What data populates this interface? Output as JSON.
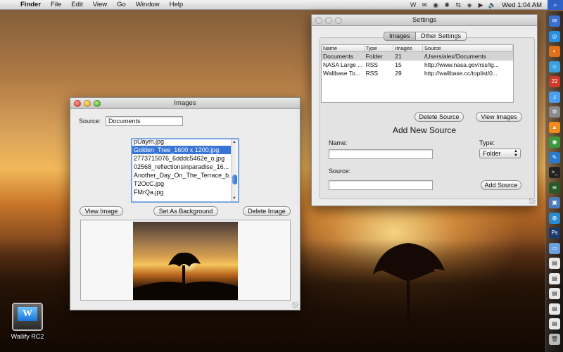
{
  "menubar": {
    "app_name": "Finder",
    "items": [
      "File",
      "Edit",
      "View",
      "Go",
      "Window",
      "Help"
    ],
    "clock": "Wed 1:04 AM",
    "status_icons": [
      "W",
      "✉",
      "◉",
      "✱",
      "⇆",
      "◈",
      "▶",
      "🔈"
    ]
  },
  "images_window": {
    "title": "Images",
    "source_label": "Source:",
    "source_value": "Documents",
    "files": [
      "pUaym.jpg",
      "Golden_Tree_1600 x 1200.jpg",
      "2773715076_6dddc5462e_o.jpg",
      "02568_reflectionsinparadise_16...",
      "Another_Day_On_The_Terrace_b...",
      "T2OcC.jpg",
      "FMrQa.jpg"
    ],
    "selected_index": 1,
    "view_image_label": "View Image",
    "set_background_label": "Set As Background",
    "delete_image_label": "Delete Image"
  },
  "settings_window": {
    "title": "Settings",
    "tabs": [
      "Images",
      "Other Settings"
    ],
    "active_tab": 0,
    "table": {
      "columns": [
        "Name",
        "Type",
        "Images",
        "Source"
      ],
      "rows": [
        [
          "Documents",
          "Folder",
          "21",
          "/Users/alex/Documents"
        ],
        [
          "NASA Large ...",
          "RSS",
          "15",
          "http://www.nasa.gov/rss/lg..."
        ],
        [
          "Wallbase To...",
          "RSS",
          "29",
          "http://wallbase.cc/toplist/0..."
        ]
      ],
      "selected_row": 0
    },
    "delete_source_label": "Delete Source",
    "view_images_label": "View Images",
    "add_new_source_title": "Add New Source",
    "name_label": "Name:",
    "name_value": "",
    "type_label": "Type:",
    "type_value": "Folder",
    "source_label": "Source:",
    "source_value": "",
    "add_source_label": "Add Source"
  },
  "desktop": {
    "app_icon_label": "Wallify RC2",
    "app_icon_glyph": "W"
  },
  "dock": {
    "icons": [
      {
        "name": "mail-icon",
        "glyph": "✉",
        "color": "#3a6fd0"
      },
      {
        "name": "safari-icon",
        "glyph": "◎",
        "color": "#2a8ee0"
      },
      {
        "name": "firefox-icon",
        "glyph": "◐",
        "color": "#e0701a"
      },
      {
        "name": "chat-icon",
        "glyph": "☺",
        "color": "#3aa0e0"
      },
      {
        "name": "calendar-icon",
        "glyph": "22",
        "color": "#d03a2a"
      },
      {
        "name": "itunes-icon",
        "glyph": "♫",
        "color": "#4aa0f0"
      },
      {
        "name": "system-preferences-icon",
        "glyph": "⚙",
        "color": "#8a8a8a"
      },
      {
        "name": "vlc-icon",
        "glyph": "▲",
        "color": "#f08a1a"
      },
      {
        "name": "chrome-icon",
        "glyph": "◉",
        "color": "#3a9a3a"
      },
      {
        "name": "editor-icon",
        "glyph": "✎",
        "color": "#2a7ad0"
      },
      {
        "name": "terminal-icon",
        "glyph": ">_",
        "color": "#222222"
      },
      {
        "name": "activity-monitor-icon",
        "glyph": "≋",
        "color": "#2a5a2a"
      },
      {
        "name": "preview-icon",
        "glyph": "▣",
        "color": "#4a7ac0"
      },
      {
        "name": "globe-icon",
        "glyph": "◍",
        "color": "#2a8ad0"
      },
      {
        "name": "photoshop-icon",
        "glyph": "Ps",
        "color": "#1a3a6a"
      },
      {
        "name": "folder-icon",
        "glyph": "▭",
        "color": "#6aa0e0"
      },
      {
        "name": "document-icon",
        "glyph": "▤",
        "color": "#e8e8e8"
      },
      {
        "name": "document-icon-2",
        "glyph": "▤",
        "color": "#e8e8e8"
      },
      {
        "name": "document-icon-3",
        "glyph": "▤",
        "color": "#e8e8e8"
      },
      {
        "name": "document-icon-4",
        "glyph": "▤",
        "color": "#e8e8e8"
      },
      {
        "name": "document-icon-5",
        "glyph": "▤",
        "color": "#e8e8e8"
      },
      {
        "name": "trash-icon",
        "glyph": "🗑",
        "color": "#bbbbbb"
      }
    ]
  }
}
